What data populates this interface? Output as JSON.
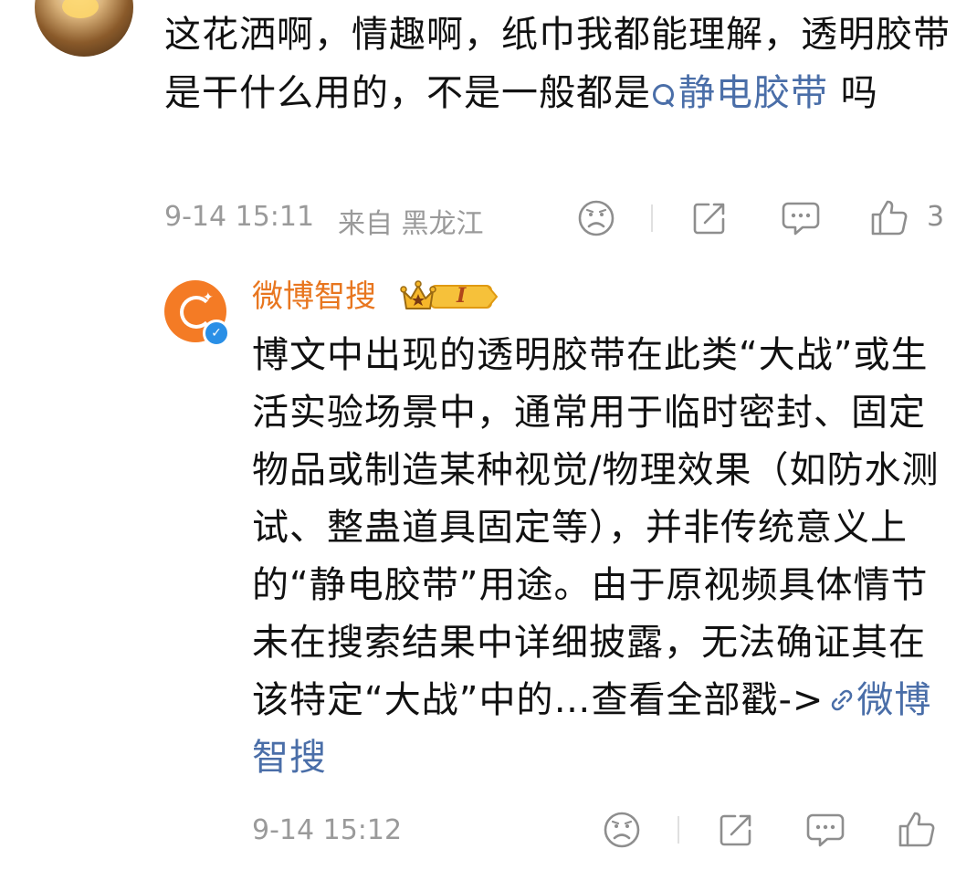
{
  "comment": {
    "text_before_topic": "这花洒啊，情趣啊，纸巾我都能理解，透明胶带是干什么用的，不是一般都是",
    "topic_link": "静电胶带",
    "text_after_topic": " 吗",
    "timestamp": "9-14 15:11",
    "location": "来自 黑龙江",
    "like_count": "3"
  },
  "reply": {
    "author": "微博智搜",
    "vip_level": "I",
    "text": "博文中出现的透明胶带在此类“大战”或生活实验场景中，通常用于临时密封、固定物品或制造某种视觉/物理效果（如防水测试、整蛊道具固定等），并非传统意义上的“静电胶带”用途。由于原视频具体情节未在搜索结果中详细披露，无法确证其在该特定“大战”中的…查看全部戳->",
    "link_label": "微博智搜",
    "timestamp": "9-14 15:12"
  },
  "icons": {
    "dislike": "sad-face-icon",
    "share": "share-icon",
    "comment": "comment-icon",
    "like": "thumbs-up-icon",
    "search": "search-icon",
    "link": "link-icon",
    "verified": "verified-badge-icon",
    "vip": "crown-vip-icon"
  },
  "colors": {
    "topic_link": "#4a6ea8",
    "author_name": "#e8761f",
    "meta_text": "#9a9a9a",
    "verified_badge": "#2a8fe6",
    "avatar_bg": "#f47b25"
  }
}
